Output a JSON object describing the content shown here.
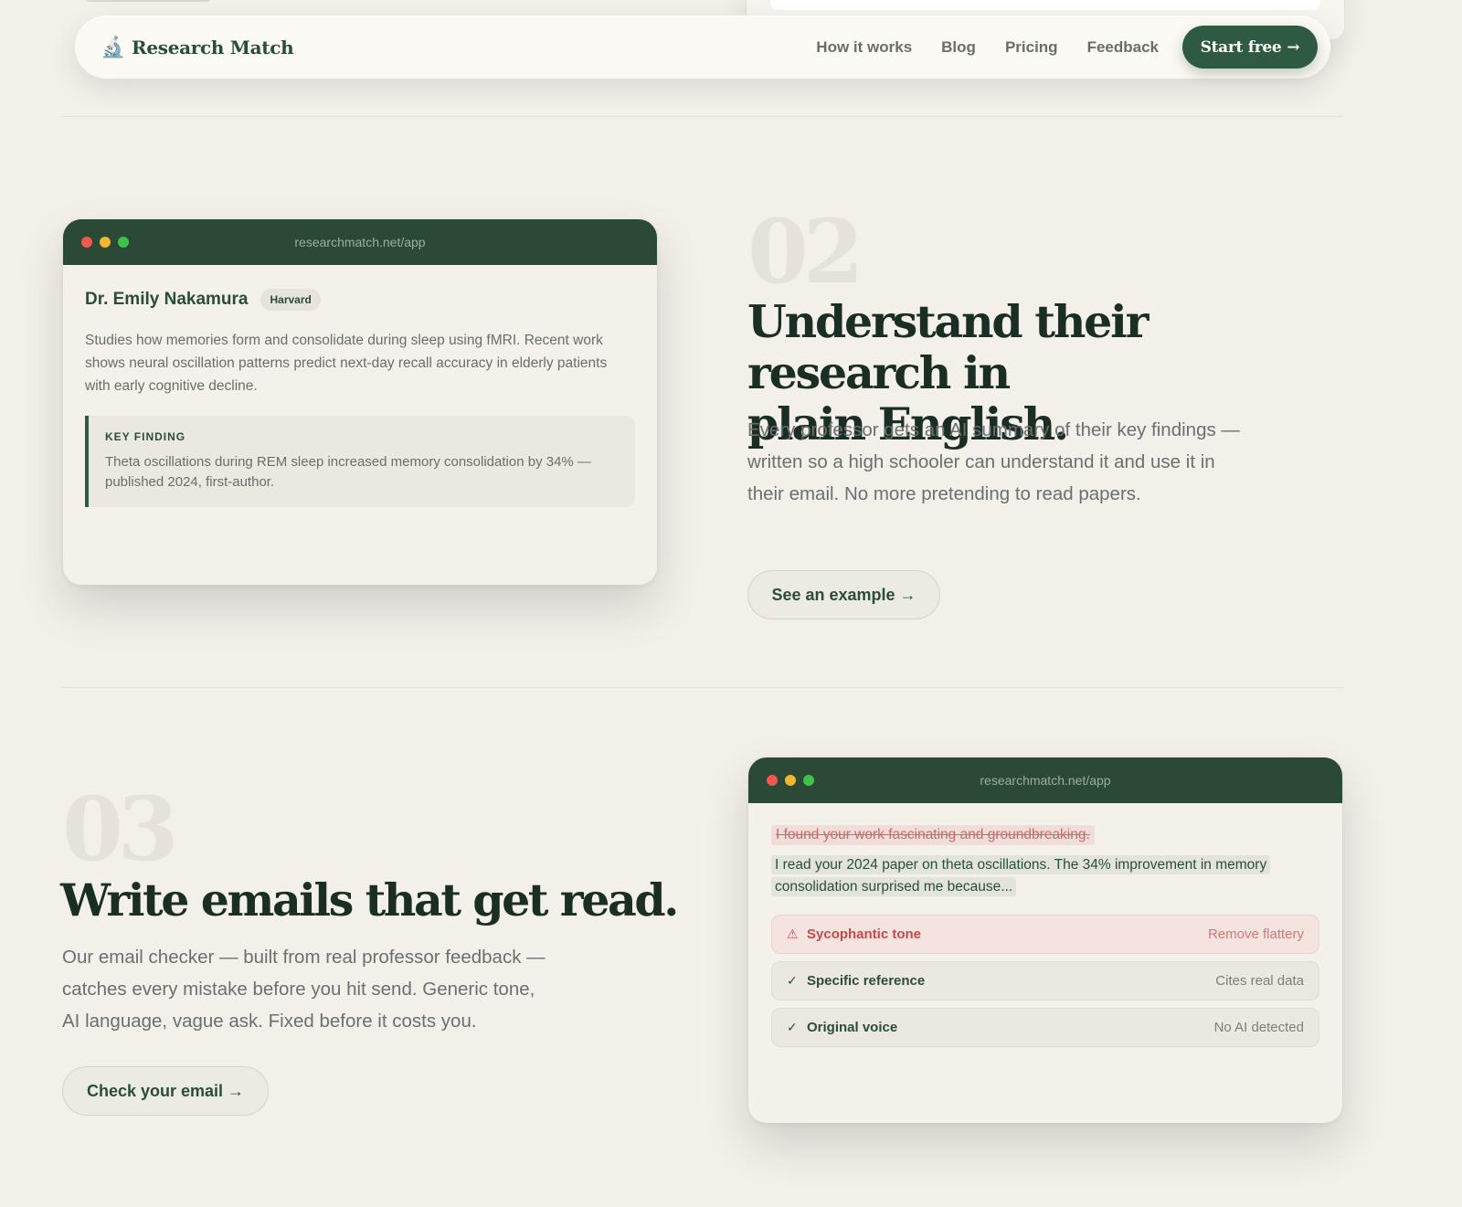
{
  "nav": {
    "brand_icon": "🔬",
    "brand_name": "Research Match",
    "links": [
      "How it works",
      "Blog",
      "Pricing",
      "Feedback"
    ],
    "cta_label": "Start free",
    "cta_arrow": "→"
  },
  "section2": {
    "number": "02",
    "headline_line1": "Understand their research in",
    "headline_line2": "plain English.",
    "lead": "Every professor gets an AI summary of their key findings — written so a high schooler can understand it and use it in their email. No more pretending to read papers.",
    "button_label": "See an example →",
    "window": {
      "url": "researchmatch.net/app",
      "professor_name": "Dr. Emily Nakamura",
      "institution": "Harvard",
      "description": "Studies how memories form and consolidate during sleep using fMRI. Recent work shows neural oscillation patterns predict next-day recall accuracy in elderly patients with early cognitive decline.",
      "finding_label": "KEY FINDING",
      "finding_text": "Theta oscillations during REM sleep increased memory consolidation by 34% — published 2024, first-author."
    }
  },
  "section3": {
    "number": "03",
    "headline": "Write emails that get read.",
    "lead": "Our email checker — built from real professor feedback — catches every mistake before you hit send. Generic tone, AI language, vague ask. Fixed before it costs you.",
    "button_label": "Check your email →",
    "window": {
      "url": "researchmatch.net/app",
      "struck_text": "I found your work fascinating and groundbreaking.",
      "improved_text": "I read your 2024 paper on theta oscillations. The 34% improvement in memory consolidation surprised me because...",
      "checks": [
        {
          "icon": "⚠",
          "label": "Sycophantic tone",
          "meta": "Remove flattery"
        },
        {
          "icon": "✓",
          "label": "Specific reference",
          "meta": "Cites real data"
        },
        {
          "icon": "✓",
          "label": "Original voice",
          "meta": "No AI detected"
        }
      ]
    }
  }
}
